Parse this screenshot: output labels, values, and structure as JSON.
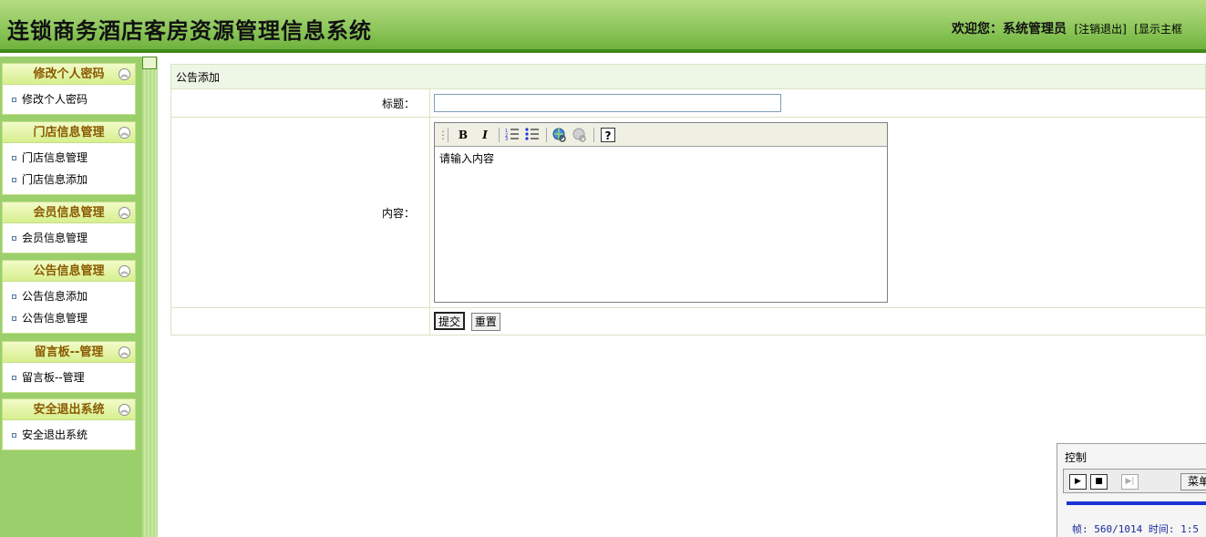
{
  "header": {
    "title": "连锁商务酒店客房资源管理信息系统",
    "welcome": "欢迎您：系统管理员",
    "logout": "[注销退出]",
    "show_main": "[显示主框"
  },
  "sidebar": {
    "groups": [
      {
        "title": "修改个人密码",
        "items": [
          "修改个人密码"
        ]
      },
      {
        "title": "门店信息管理",
        "items": [
          "门店信息管理",
          "门店信息添加"
        ]
      },
      {
        "title": "会员信息管理",
        "items": [
          "会员信息管理"
        ]
      },
      {
        "title": "公告信息管理",
        "items": [
          "公告信息添加",
          "公告信息管理"
        ]
      },
      {
        "title": "留言板--管理",
        "items": [
          "留言板--管理"
        ]
      },
      {
        "title": "安全退出系统",
        "items": [
          "安全退出系统"
        ]
      }
    ]
  },
  "form": {
    "caption": "公告添加",
    "title_label": "标题：",
    "title_value": "",
    "content_label": "内容：",
    "content_value": "请输入内容",
    "submit": "提交",
    "reset": "重置",
    "toolbar": {
      "bold": "B",
      "italic": "I",
      "help": "?"
    }
  },
  "control": {
    "title": "控制",
    "menu": "菜单",
    "status": "帧: 560/1014 时间: 1:5"
  }
}
